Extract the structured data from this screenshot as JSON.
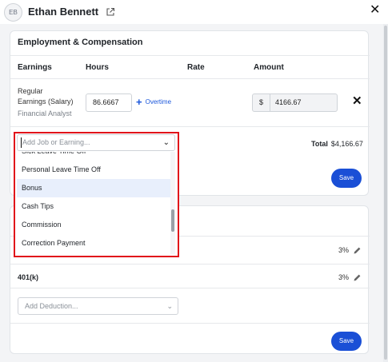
{
  "header": {
    "avatar_initials": "EB",
    "user_name": "Ethan Bennett",
    "close_glyph": "✕"
  },
  "employment": {
    "title": "Employment & Compensation",
    "columns": {
      "earnings": "Earnings",
      "hours": "Hours",
      "rate": "Rate",
      "amount": "Amount"
    },
    "earning_row": {
      "label_line1": "Regular",
      "label_line2": "Earnings (Salary)",
      "job": "Financial Analyst",
      "hours": "86.6667",
      "overtime_label": "Overtime",
      "currency": "$",
      "amount": "4166.67"
    },
    "add_placeholder": "Add Job or Earning...",
    "total_label": "Total",
    "total_value": "$4,166.67",
    "save_label": "Save"
  },
  "dropdown": {
    "items": [
      {
        "label": "Sick Leave Time Off",
        "active": false
      },
      {
        "label": "Personal Leave Time Off",
        "active": false
      },
      {
        "label": "Bonus",
        "active": true
      },
      {
        "label": "Cash Tips",
        "active": false
      },
      {
        "label": "Commission",
        "active": false
      },
      {
        "label": "Correction Payment",
        "active": false
      }
    ]
  },
  "deductions": {
    "rows": [
      {
        "name": "",
        "percent": "3%"
      },
      {
        "name": "401(k)",
        "percent": "3%"
      }
    ],
    "add_placeholder": "Add Deduction...",
    "save_label": "Save"
  },
  "colors": {
    "accent": "#1a4fd6",
    "highlight_frame": "#e1111a",
    "active_item": "#e8effc"
  }
}
